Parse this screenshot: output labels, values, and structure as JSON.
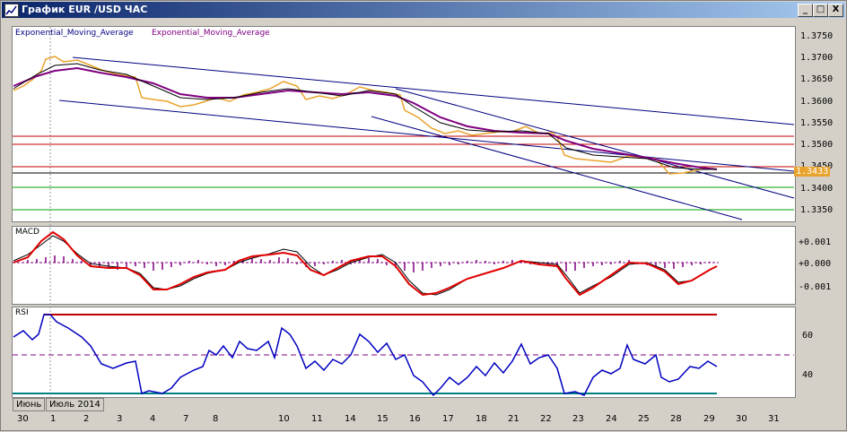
{
  "window": {
    "title": "График EUR /USD  ЧАС",
    "buttons": [
      "_",
      "□",
      "X"
    ]
  },
  "price_panel": {
    "indicator_labels": [
      "Exponential_Moving_Average",
      "Exponential_Moving_Average"
    ],
    "y_ticks": [
      "1.3750",
      "1.3700",
      "1.3650",
      "1.3600",
      "1.3550",
      "1.3500",
      "1.3450",
      "1.3400",
      "1.3350"
    ],
    "current_price": "1.3433"
  },
  "macd_panel": {
    "label": "MACD",
    "y_ticks": [
      "+0.001",
      "+0.000",
      "-0.001"
    ]
  },
  "rsi_panel": {
    "label": "RSI",
    "y_ticks": [
      "60",
      "40"
    ]
  },
  "x_axis": {
    "ticks": [
      "30",
      "1",
      "2",
      "3",
      "4",
      "7",
      "8",
      "10",
      "11",
      "14",
      "15",
      "16",
      "17",
      "18",
      "21",
      "22",
      "23",
      "24",
      "25",
      "28",
      "29",
      "30",
      "31"
    ],
    "month_labels": [
      "Июнь",
      "Июль 2014"
    ]
  },
  "colors": {
    "price": "#e8a32c",
    "ema_fast": "#000000",
    "ema_slow": "#800080",
    "trendline": "#000080",
    "resistance": "#c00000",
    "support": "#00a000",
    "macd_line": "#e00000",
    "signal_line": "#000000",
    "histogram": "#800080",
    "rsi": "#0000c0",
    "rsi_upper": "#c00000",
    "rsi_mid": "#800080",
    "rsi_lower": "#008080"
  }
}
